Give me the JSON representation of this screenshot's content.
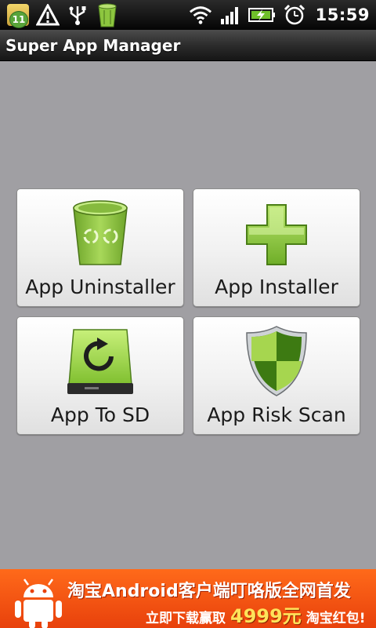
{
  "status_bar": {
    "notification_count": "11",
    "clock": "15:59",
    "icons": [
      "notification-folder-icon",
      "warning-icon",
      "usb-icon",
      "recycle-bin-icon",
      "wifi-icon",
      "signal-icon",
      "battery-charging-icon",
      "alarm-icon"
    ]
  },
  "app": {
    "title": "Super App Manager"
  },
  "tiles": [
    {
      "label": "App Uninstaller",
      "icon": "trash-bin-icon"
    },
    {
      "label": "App Installer",
      "icon": "plus-icon"
    },
    {
      "label": "App To SD",
      "icon": "sd-drive-icon"
    },
    {
      "label": "App Risk Scan",
      "icon": "shield-icon"
    }
  ],
  "ad": {
    "headline": "淘宝Android客户端叮咯版全网首发",
    "subline_prefix": "立即下载赢取",
    "amount": "4999元",
    "subline_suffix": "淘宝红包!",
    "icon": "android-robot-icon"
  },
  "colors": {
    "background": "#a09fa3",
    "accent_green": "#8dc63f",
    "ad_orange": "#f05a14"
  }
}
